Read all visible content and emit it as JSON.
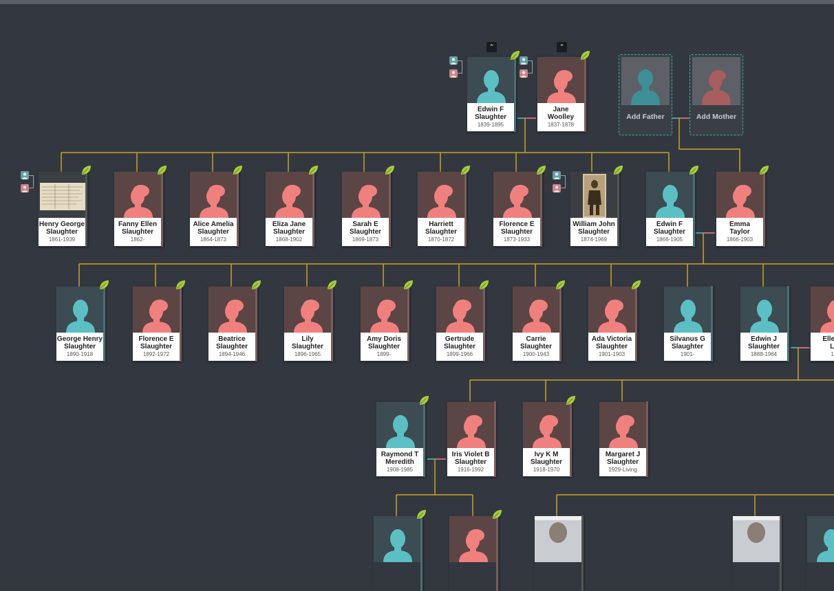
{
  "add_father_label": "Add Father",
  "add_mother_label": "Add Mother",
  "colors": {
    "line": "#c9a227",
    "male": "#5bbfc4",
    "female": "#f0807e",
    "leaf": "#a8cc3c"
  },
  "people": {
    "edwin_f_1839": {
      "name1": "Edwin F",
      "name2": "Slaughter",
      "dates": "1839-1895"
    },
    "jane_woolley": {
      "name1": "Jane",
      "name2": "Woolley",
      "dates": "1837-1878"
    },
    "henry_george": {
      "name1": "Henry George",
      "name2": "Slaughter",
      "dates": "1861-1939"
    },
    "fanny_ellen": {
      "name1": "Fanny Ellen",
      "name2": "Slaughter",
      "dates": "1862-"
    },
    "alice_amelia": {
      "name1": "Alice Amelia",
      "name2": "Slaughter",
      "dates": "1864-1873"
    },
    "eliza_jane": {
      "name1": "Eliza Jane",
      "name2": "Slaughter",
      "dates": "1868-1902"
    },
    "sarah_e": {
      "name1": "Sarah E",
      "name2": "Slaughter",
      "dates": "1869-1873"
    },
    "harriett": {
      "name1": "Harriett",
      "name2": "Slaughter",
      "dates": "1870-1872"
    },
    "florence_e_1873": {
      "name1": "Florence E",
      "name2": "Slaughter",
      "dates": "1873-1933"
    },
    "william_john": {
      "name1": "William John",
      "name2": "Slaughter",
      "dates": "1874-1969"
    },
    "edwin_f_1866": {
      "name1": "Edwin F",
      "name2": "Slaughter",
      "dates": "1866-1905"
    },
    "emma_taylor": {
      "name1": "Emma",
      "name2": "Taylor",
      "dates": "1866-1903"
    },
    "george_henry": {
      "name1": "George Henry",
      "name2": "Slaughter",
      "dates": "1890-1918"
    },
    "florence_e_1892": {
      "name1": "Florence E",
      "name2": "Slaughter",
      "dates": "1892-1972"
    },
    "beatrice": {
      "name1": "Beatrice",
      "name2": "Slaughter",
      "dates": "1894-1946"
    },
    "lily": {
      "name1": "Lily",
      "name2": "Slaughter",
      "dates": "1896-1965"
    },
    "amy_doris": {
      "name1": "Amy Doris",
      "name2": "Slaughter",
      "dates": "1899-"
    },
    "gertrude": {
      "name1": "Gertrude",
      "name2": "Slaughter",
      "dates": "1899-1966"
    },
    "carrie": {
      "name1": "Carrie",
      "name2": "Slaughter",
      "dates": "1900-1943"
    },
    "ada_victoria": {
      "name1": "Ada Victoria",
      "name2": "Slaughter",
      "dates": "1901-1903"
    },
    "silvanus_g": {
      "name1": "Silvanus G",
      "name2": "Slaughter",
      "dates": "1901-"
    },
    "edwin_j": {
      "name1": "Edwin J",
      "name2": "Slaughter",
      "dates": "1888-1964"
    },
    "ellen_e": {
      "name1": "Ellen E",
      "name2": "Le",
      "dates": "18"
    },
    "raymond_t": {
      "name1": "Raymond T",
      "name2": "Meredith",
      "dates": "1908-1985"
    },
    "iris_violet": {
      "name1": "Iris Violet B",
      "name2": "Slaughter",
      "dates": "1916-1992"
    },
    "ivy_km": {
      "name1": "Ivy K M",
      "name2": "Slaughter",
      "dates": "1918-1970"
    },
    "margaret_j": {
      "name1": "Margaret J",
      "name2": "Slaughter",
      "dates": "1929-Living"
    }
  }
}
